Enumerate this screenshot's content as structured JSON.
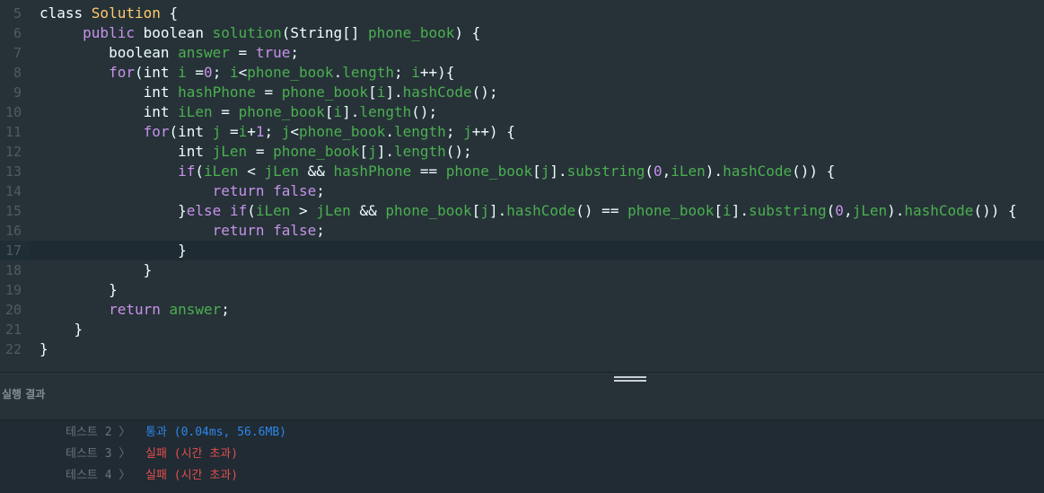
{
  "editor": {
    "lines": [
      {
        "n": "5",
        "tokens": [
          [
            "class ",
            "tk-plain"
          ],
          [
            "Solution",
            "tk-cls"
          ],
          [
            " {",
            "tk-plain"
          ]
        ]
      },
      {
        "n": "6",
        "tokens": [
          [
            "     public ",
            "tk-purple"
          ],
          [
            "boolean ",
            "tk-plain"
          ],
          [
            "solution",
            "tk-green"
          ],
          [
            "(String[] ",
            "tk-plain"
          ],
          [
            "phone_book",
            "tk-green"
          ],
          [
            ") {",
            "tk-plain"
          ]
        ]
      },
      {
        "n": "7",
        "tokens": [
          [
            "        boolean ",
            "tk-plain"
          ],
          [
            "answer",
            "tk-green"
          ],
          [
            " = ",
            "tk-plain"
          ],
          [
            "true",
            "tk-purple"
          ],
          [
            ";",
            "tk-plain"
          ]
        ]
      },
      {
        "n": "8",
        "tokens": [
          [
            "        for",
            "tk-purple"
          ],
          [
            "(int ",
            "tk-plain"
          ],
          [
            "i",
            "tk-green"
          ],
          [
            " =",
            "tk-plain"
          ],
          [
            "0",
            "tk-purple"
          ],
          [
            "; ",
            "tk-plain"
          ],
          [
            "i",
            "tk-green"
          ],
          [
            "<",
            "tk-plain"
          ],
          [
            "phone_book",
            "tk-green"
          ],
          [
            ".",
            "tk-plain"
          ],
          [
            "length",
            "tk-green"
          ],
          [
            "; ",
            "tk-plain"
          ],
          [
            "i",
            "tk-green"
          ],
          [
            "++){",
            "tk-plain"
          ]
        ]
      },
      {
        "n": "9",
        "tokens": [
          [
            "            int ",
            "tk-plain"
          ],
          [
            "hashPhone",
            "tk-green"
          ],
          [
            " = ",
            "tk-plain"
          ],
          [
            "phone_book",
            "tk-green"
          ],
          [
            "[",
            "tk-plain"
          ],
          [
            "i",
            "tk-green"
          ],
          [
            "].",
            "tk-plain"
          ],
          [
            "hashCode",
            "tk-green"
          ],
          [
            "();",
            "tk-plain"
          ]
        ]
      },
      {
        "n": "10",
        "tokens": [
          [
            "            int ",
            "tk-plain"
          ],
          [
            "iLen",
            "tk-green"
          ],
          [
            " = ",
            "tk-plain"
          ],
          [
            "phone_book",
            "tk-green"
          ],
          [
            "[",
            "tk-plain"
          ],
          [
            "i",
            "tk-green"
          ],
          [
            "].",
            "tk-plain"
          ],
          [
            "length",
            "tk-green"
          ],
          [
            "();",
            "tk-plain"
          ]
        ]
      },
      {
        "n": "11",
        "tokens": [
          [
            "            for",
            "tk-purple"
          ],
          [
            "(int ",
            "tk-plain"
          ],
          [
            "j",
            "tk-green"
          ],
          [
            " =",
            "tk-plain"
          ],
          [
            "i",
            "tk-green"
          ],
          [
            "+",
            "tk-plain"
          ],
          [
            "1",
            "tk-purple"
          ],
          [
            "; ",
            "tk-plain"
          ],
          [
            "j",
            "tk-green"
          ],
          [
            "<",
            "tk-plain"
          ],
          [
            "phone_book",
            "tk-green"
          ],
          [
            ".",
            "tk-plain"
          ],
          [
            "length",
            "tk-green"
          ],
          [
            "; ",
            "tk-plain"
          ],
          [
            "j",
            "tk-green"
          ],
          [
            "++) {",
            "tk-plain"
          ]
        ]
      },
      {
        "n": "12",
        "tokens": [
          [
            "                int ",
            "tk-plain"
          ],
          [
            "jLen",
            "tk-green"
          ],
          [
            " = ",
            "tk-plain"
          ],
          [
            "phone_book",
            "tk-green"
          ],
          [
            "[",
            "tk-plain"
          ],
          [
            "j",
            "tk-green"
          ],
          [
            "].",
            "tk-plain"
          ],
          [
            "length",
            "tk-green"
          ],
          [
            "();",
            "tk-plain"
          ]
        ]
      },
      {
        "n": "13",
        "tokens": [
          [
            "                if",
            "tk-purple"
          ],
          [
            "(",
            "tk-plain"
          ],
          [
            "iLen",
            "tk-green"
          ],
          [
            " < ",
            "tk-plain"
          ],
          [
            "jLen",
            "tk-green"
          ],
          [
            " && ",
            "tk-plain"
          ],
          [
            "hashPhone",
            "tk-green"
          ],
          [
            " == ",
            "tk-plain"
          ],
          [
            "phone_book",
            "tk-green"
          ],
          [
            "[",
            "tk-plain"
          ],
          [
            "j",
            "tk-green"
          ],
          [
            "].",
            "tk-plain"
          ],
          [
            "substring",
            "tk-green"
          ],
          [
            "(",
            "tk-plain"
          ],
          [
            "0",
            "tk-purple"
          ],
          [
            ",",
            "tk-plain"
          ],
          [
            "iLen",
            "tk-green"
          ],
          [
            ").",
            "tk-plain"
          ],
          [
            "hashCode",
            "tk-green"
          ],
          [
            "()) {",
            "tk-plain"
          ]
        ]
      },
      {
        "n": "14",
        "tokens": [
          [
            "                    return ",
            "tk-purple"
          ],
          [
            "false",
            "tk-purple"
          ],
          [
            ";",
            "tk-plain"
          ]
        ]
      },
      {
        "n": "15",
        "tokens": [
          [
            "                }",
            "tk-plain"
          ],
          [
            "else ",
            "tk-purple"
          ],
          [
            "if",
            "tk-purple"
          ],
          [
            "(",
            "tk-plain"
          ],
          [
            "iLen",
            "tk-green"
          ],
          [
            " > ",
            "tk-plain"
          ],
          [
            "jLen",
            "tk-green"
          ],
          [
            " && ",
            "tk-plain"
          ],
          [
            "phone_book",
            "tk-green"
          ],
          [
            "[",
            "tk-plain"
          ],
          [
            "j",
            "tk-green"
          ],
          [
            "].",
            "tk-plain"
          ],
          [
            "hashCode",
            "tk-green"
          ],
          [
            "() == ",
            "tk-plain"
          ],
          [
            "phone_book",
            "tk-green"
          ],
          [
            "[",
            "tk-plain"
          ],
          [
            "i",
            "tk-green"
          ],
          [
            "].",
            "tk-plain"
          ],
          [
            "substring",
            "tk-green"
          ],
          [
            "(",
            "tk-plain"
          ],
          [
            "0",
            "tk-purple"
          ],
          [
            ",",
            "tk-plain"
          ],
          [
            "jLen",
            "tk-green"
          ],
          [
            ").",
            "tk-plain"
          ],
          [
            "hashCode",
            "tk-green"
          ],
          [
            "()) {",
            "tk-plain"
          ]
        ]
      },
      {
        "n": "16",
        "tokens": [
          [
            "                    return ",
            "tk-purple"
          ],
          [
            "false",
            "tk-purple"
          ],
          [
            ";",
            "tk-plain"
          ]
        ]
      },
      {
        "n": "17",
        "tokens": [
          [
            "                }",
            "tk-plain"
          ]
        ],
        "active": true
      },
      {
        "n": "18",
        "tokens": [
          [
            "            }",
            "tk-plain"
          ]
        ]
      },
      {
        "n": "19",
        "tokens": [
          [
            "        }",
            "tk-plain"
          ]
        ]
      },
      {
        "n": "20",
        "tokens": [
          [
            "        return ",
            "tk-purple"
          ],
          [
            "answer",
            "tk-green"
          ],
          [
            ";",
            "tk-plain"
          ]
        ]
      },
      {
        "n": "21",
        "tokens": [
          [
            "    }",
            "tk-plain"
          ]
        ]
      },
      {
        "n": "22",
        "tokens": [
          [
            "}",
            "tk-plain"
          ]
        ]
      }
    ]
  },
  "results": {
    "title": "실행 결과",
    "rows": [
      {
        "label": "테스트 2 〉",
        "status": "통과 (0.04ms, 56.6MB)",
        "state": "pass"
      },
      {
        "label": "테스트 3 〉",
        "status": "실패 (시간 초과)",
        "state": "fail"
      },
      {
        "label": "테스트 4 〉",
        "status": "실패 (시간 초과)",
        "state": "fail"
      }
    ]
  }
}
